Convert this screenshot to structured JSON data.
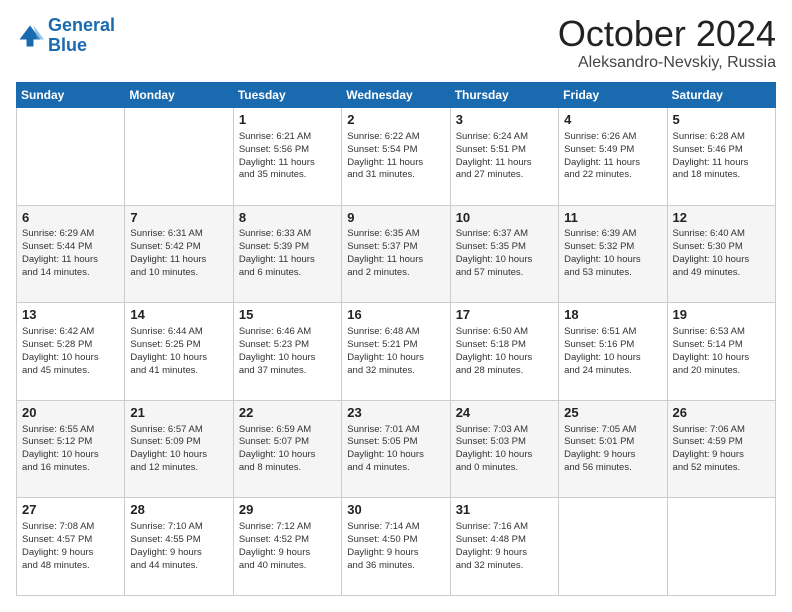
{
  "logo": {
    "line1": "General",
    "line2": "Blue"
  },
  "header": {
    "month": "October 2024",
    "location": "Aleksandro-Nevskiy, Russia"
  },
  "weekdays": [
    "Sunday",
    "Monday",
    "Tuesday",
    "Wednesday",
    "Thursday",
    "Friday",
    "Saturday"
  ],
  "weeks": [
    [
      {
        "day": "",
        "info": ""
      },
      {
        "day": "",
        "info": ""
      },
      {
        "day": "1",
        "info": "Sunrise: 6:21 AM\nSunset: 5:56 PM\nDaylight: 11 hours\nand 35 minutes."
      },
      {
        "day": "2",
        "info": "Sunrise: 6:22 AM\nSunset: 5:54 PM\nDaylight: 11 hours\nand 31 minutes."
      },
      {
        "day": "3",
        "info": "Sunrise: 6:24 AM\nSunset: 5:51 PM\nDaylight: 11 hours\nand 27 minutes."
      },
      {
        "day": "4",
        "info": "Sunrise: 6:26 AM\nSunset: 5:49 PM\nDaylight: 11 hours\nand 22 minutes."
      },
      {
        "day": "5",
        "info": "Sunrise: 6:28 AM\nSunset: 5:46 PM\nDaylight: 11 hours\nand 18 minutes."
      }
    ],
    [
      {
        "day": "6",
        "info": "Sunrise: 6:29 AM\nSunset: 5:44 PM\nDaylight: 11 hours\nand 14 minutes."
      },
      {
        "day": "7",
        "info": "Sunrise: 6:31 AM\nSunset: 5:42 PM\nDaylight: 11 hours\nand 10 minutes."
      },
      {
        "day": "8",
        "info": "Sunrise: 6:33 AM\nSunset: 5:39 PM\nDaylight: 11 hours\nand 6 minutes."
      },
      {
        "day": "9",
        "info": "Sunrise: 6:35 AM\nSunset: 5:37 PM\nDaylight: 11 hours\nand 2 minutes."
      },
      {
        "day": "10",
        "info": "Sunrise: 6:37 AM\nSunset: 5:35 PM\nDaylight: 10 hours\nand 57 minutes."
      },
      {
        "day": "11",
        "info": "Sunrise: 6:39 AM\nSunset: 5:32 PM\nDaylight: 10 hours\nand 53 minutes."
      },
      {
        "day": "12",
        "info": "Sunrise: 6:40 AM\nSunset: 5:30 PM\nDaylight: 10 hours\nand 49 minutes."
      }
    ],
    [
      {
        "day": "13",
        "info": "Sunrise: 6:42 AM\nSunset: 5:28 PM\nDaylight: 10 hours\nand 45 minutes."
      },
      {
        "day": "14",
        "info": "Sunrise: 6:44 AM\nSunset: 5:25 PM\nDaylight: 10 hours\nand 41 minutes."
      },
      {
        "day": "15",
        "info": "Sunrise: 6:46 AM\nSunset: 5:23 PM\nDaylight: 10 hours\nand 37 minutes."
      },
      {
        "day": "16",
        "info": "Sunrise: 6:48 AM\nSunset: 5:21 PM\nDaylight: 10 hours\nand 32 minutes."
      },
      {
        "day": "17",
        "info": "Sunrise: 6:50 AM\nSunset: 5:18 PM\nDaylight: 10 hours\nand 28 minutes."
      },
      {
        "day": "18",
        "info": "Sunrise: 6:51 AM\nSunset: 5:16 PM\nDaylight: 10 hours\nand 24 minutes."
      },
      {
        "day": "19",
        "info": "Sunrise: 6:53 AM\nSunset: 5:14 PM\nDaylight: 10 hours\nand 20 minutes."
      }
    ],
    [
      {
        "day": "20",
        "info": "Sunrise: 6:55 AM\nSunset: 5:12 PM\nDaylight: 10 hours\nand 16 minutes."
      },
      {
        "day": "21",
        "info": "Sunrise: 6:57 AM\nSunset: 5:09 PM\nDaylight: 10 hours\nand 12 minutes."
      },
      {
        "day": "22",
        "info": "Sunrise: 6:59 AM\nSunset: 5:07 PM\nDaylight: 10 hours\nand 8 minutes."
      },
      {
        "day": "23",
        "info": "Sunrise: 7:01 AM\nSunset: 5:05 PM\nDaylight: 10 hours\nand 4 minutes."
      },
      {
        "day": "24",
        "info": "Sunrise: 7:03 AM\nSunset: 5:03 PM\nDaylight: 10 hours\nand 0 minutes."
      },
      {
        "day": "25",
        "info": "Sunrise: 7:05 AM\nSunset: 5:01 PM\nDaylight: 9 hours\nand 56 minutes."
      },
      {
        "day": "26",
        "info": "Sunrise: 7:06 AM\nSunset: 4:59 PM\nDaylight: 9 hours\nand 52 minutes."
      }
    ],
    [
      {
        "day": "27",
        "info": "Sunrise: 7:08 AM\nSunset: 4:57 PM\nDaylight: 9 hours\nand 48 minutes."
      },
      {
        "day": "28",
        "info": "Sunrise: 7:10 AM\nSunset: 4:55 PM\nDaylight: 9 hours\nand 44 minutes."
      },
      {
        "day": "29",
        "info": "Sunrise: 7:12 AM\nSunset: 4:52 PM\nDaylight: 9 hours\nand 40 minutes."
      },
      {
        "day": "30",
        "info": "Sunrise: 7:14 AM\nSunset: 4:50 PM\nDaylight: 9 hours\nand 36 minutes."
      },
      {
        "day": "31",
        "info": "Sunrise: 7:16 AM\nSunset: 4:48 PM\nDaylight: 9 hours\nand 32 minutes."
      },
      {
        "day": "",
        "info": ""
      },
      {
        "day": "",
        "info": ""
      }
    ]
  ]
}
